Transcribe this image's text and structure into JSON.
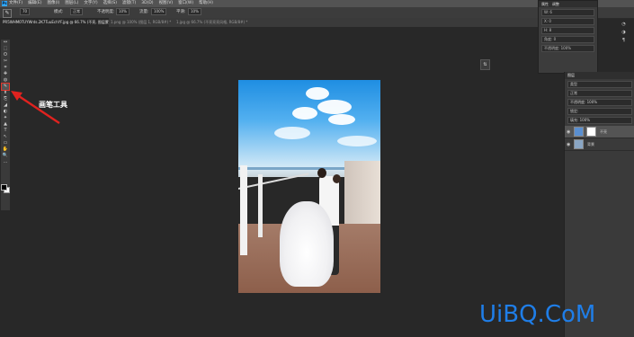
{
  "menubar": {
    "logo": "Ps",
    "menus": [
      "文件(F)",
      "编辑(E)",
      "图像(I)",
      "图层(L)",
      "文字(Y)",
      "选择(S)",
      "滤镜(T)",
      "3D(D)",
      "视图(V)",
      "窗口(W)",
      "帮助(H)"
    ]
  },
  "options": {
    "size": "70",
    "mode_label": "模式:",
    "mode": "正常",
    "opacity_label": "不透明度:",
    "opacity": "10%",
    "flow_label": "流量:",
    "flow": "100%",
    "smoothing_label": "平滑:",
    "smoothing": "10%"
  },
  "tabs": [
    {
      "label": "PR5WHM0TUYWrds.2K7TuuEchYF.jpg @ 66.7% (不亮, 图层蒙版/8) *"
    },
    {
      "label": "1.png @ 100% (图层 1, RGB/8#) *"
    },
    {
      "label": "1.jpg @ 66.7% (不亮亮亮风格, RGB/8#) *"
    }
  ],
  "tools": [
    "↔",
    "⬚",
    "ʘ",
    "✂",
    "⌗",
    "✚",
    "◍",
    "✎",
    "⬆",
    "⎘",
    "◢",
    "◐",
    "✦",
    "▲",
    "T",
    "↖",
    "▭",
    "✋",
    "🔍",
    "…"
  ],
  "annotation": "画笔工具",
  "properties": {
    "tabs": [
      "属性",
      "调整"
    ],
    "rows": [
      "W: 6",
      "X: 0",
      "H: 8",
      "角度: 0",
      "不透明度: 100%"
    ]
  },
  "layers": {
    "title": "图层",
    "kind": "类型",
    "mode": "正常",
    "opacity": "不透明度: 100%",
    "lock": "锁定:",
    "fill": "填充: 100%",
    "items": [
      {
        "name": "不亮",
        "selected": true
      },
      {
        "name": "背景",
        "selected": false
      }
    ]
  },
  "colors": {
    "accent": "#31a8ff",
    "annotation_arrow": "#e0221f",
    "watermark": "#1f7ee8"
  },
  "watermark": "UiBQ.CoM"
}
